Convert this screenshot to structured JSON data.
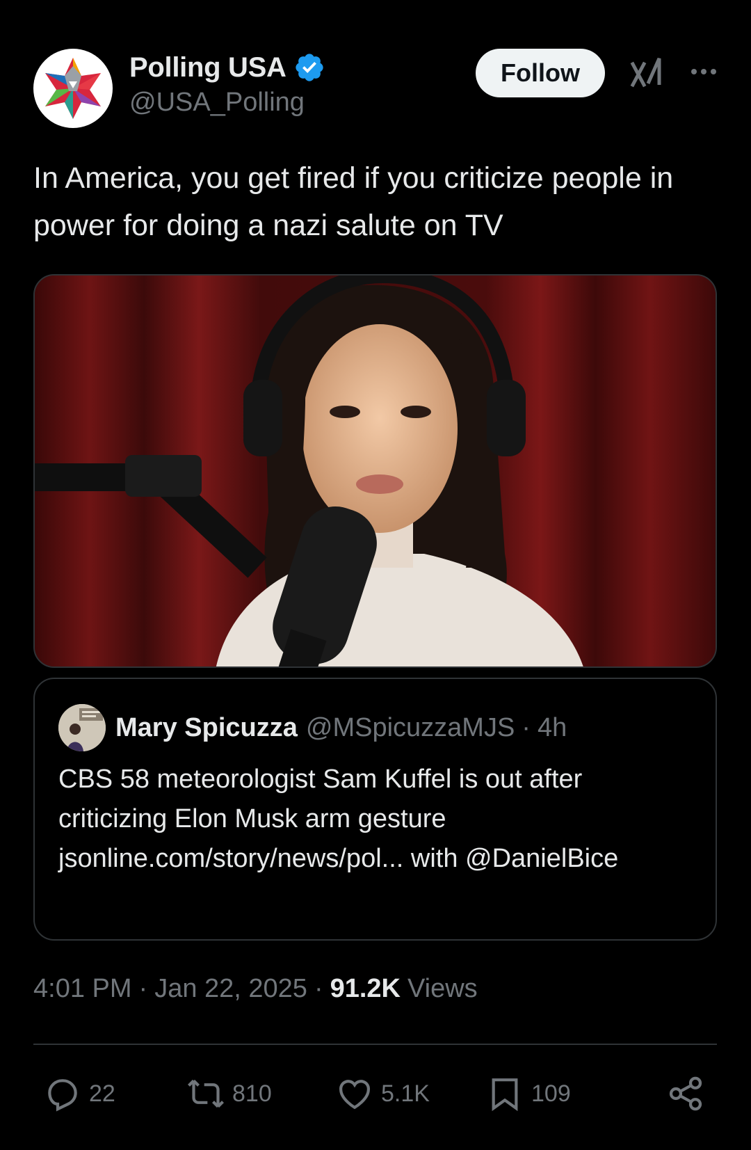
{
  "author": {
    "display_name": "Polling USA",
    "handle": "@USA_Polling",
    "verified": true,
    "avatar_icon": "star-logo-icon"
  },
  "header": {
    "follow_label": "Follow",
    "grok_icon": "grok-icon",
    "more_icon": "more-options-icon"
  },
  "tweet": {
    "text": "In America, you get fired if you criticize people in power for doing a nazi salute on TV"
  },
  "media": {
    "alt": "Video still of a woman with headphones speaking into a microphone in front of a red curtain"
  },
  "quote": {
    "display_name": "Mary Spicuzza",
    "handle": "@MSpicuzzaMJS",
    "separator": "·",
    "time": "4h",
    "text": "CBS 58 meteorologist Sam Kuffel is out after criticizing Elon Musk arm gesture jsonline.com/story/news/pol... with @DanielBice"
  },
  "meta": {
    "time": "4:01 PM",
    "separator": "·",
    "date": "Jan 22, 2025",
    "views_count": "91.2K",
    "views_label": "Views"
  },
  "actions": {
    "replies": "22",
    "reposts": "810",
    "likes": "5.1K",
    "bookmarks": "109"
  },
  "colors": {
    "background": "#000000",
    "text_primary": "#e7e9ea",
    "text_secondary": "#71767b",
    "border": "#2f3336",
    "verified_blue": "#1d9bf0",
    "follow_bg": "#eff3f4"
  }
}
